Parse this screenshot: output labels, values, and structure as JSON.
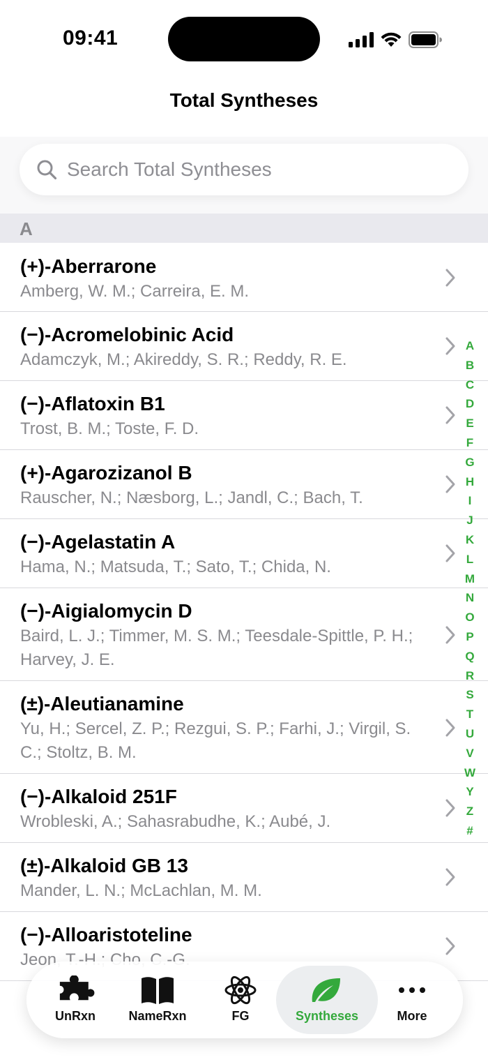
{
  "status_bar": {
    "time": "09:41"
  },
  "nav": {
    "title": "Total Syntheses"
  },
  "search": {
    "placeholder": "Search Total Syntheses",
    "value": ""
  },
  "section": {
    "letter": "A"
  },
  "items": [
    {
      "title": "(+)-Aberrarone",
      "authors": "Amberg, W. M.; Carreira, E. M."
    },
    {
      "title": "(−)-Acromelobinic Acid",
      "authors": "Adamczyk, M.; Akireddy, S. R.; Reddy, R. E."
    },
    {
      "title": "(−)-Aflatoxin B1",
      "authors": "Trost, B. M.;  Toste, F. D."
    },
    {
      "title": "(+)-Agarozizanol B",
      "authors": "Rauscher, N.; Næsborg, L.; Jandl, C.; Bach, T."
    },
    {
      "title": "(−)-Agelastatin A",
      "authors": "Hama, N.; Matsuda, T.; Sato, T.; Chida, N."
    },
    {
      "title": "(−)-Aigialomycin D",
      "authors": "Baird, L. J.;  Timmer, M. S. M.;  Teesdale-Spittle, P. H.;  Harvey, J. E."
    },
    {
      "title": "(±)-Aleutianamine",
      "authors": "Yu, H.;  Sercel, Z. P.;  Rezgui, S. P.;  Farhi, J.;  Virgil, S. C.;  Stoltz, B. M."
    },
    {
      "title": "(−)-Alkaloid 251F",
      "authors": "Wrobleski, A.;  Sahasrabudhe, K.;  Aubé, J."
    },
    {
      "title": "(±)-Alkaloid GB 13",
      "authors": "Mander, L. N.; McLachlan, M. M."
    },
    {
      "title": "(−)-Alloaristoteline",
      "authors": "Jeon, T.-H.;  Cho, C.-G."
    }
  ],
  "index_letters": [
    "A",
    "B",
    "C",
    "D",
    "E",
    "F",
    "G",
    "H",
    "I",
    "J",
    "K",
    "L",
    "M",
    "N",
    "O",
    "P",
    "Q",
    "R",
    "S",
    "T",
    "U",
    "V",
    "W",
    "Y",
    "Z",
    "#"
  ],
  "tabs": [
    {
      "label": "UnRxn",
      "icon": "puzzle-icon",
      "active": false
    },
    {
      "label": "NameRxn",
      "icon": "book-icon",
      "active": false
    },
    {
      "label": "FG",
      "icon": "atom-icon",
      "active": false
    },
    {
      "label": "Syntheses",
      "icon": "leaf-icon",
      "active": true
    },
    {
      "label": "More",
      "icon": "ellipsis-icon",
      "active": false
    }
  ],
  "colors": {
    "accent": "#34a93c",
    "secondary_text": "#8a8a8e",
    "section_bg": "#e9e9ee"
  }
}
